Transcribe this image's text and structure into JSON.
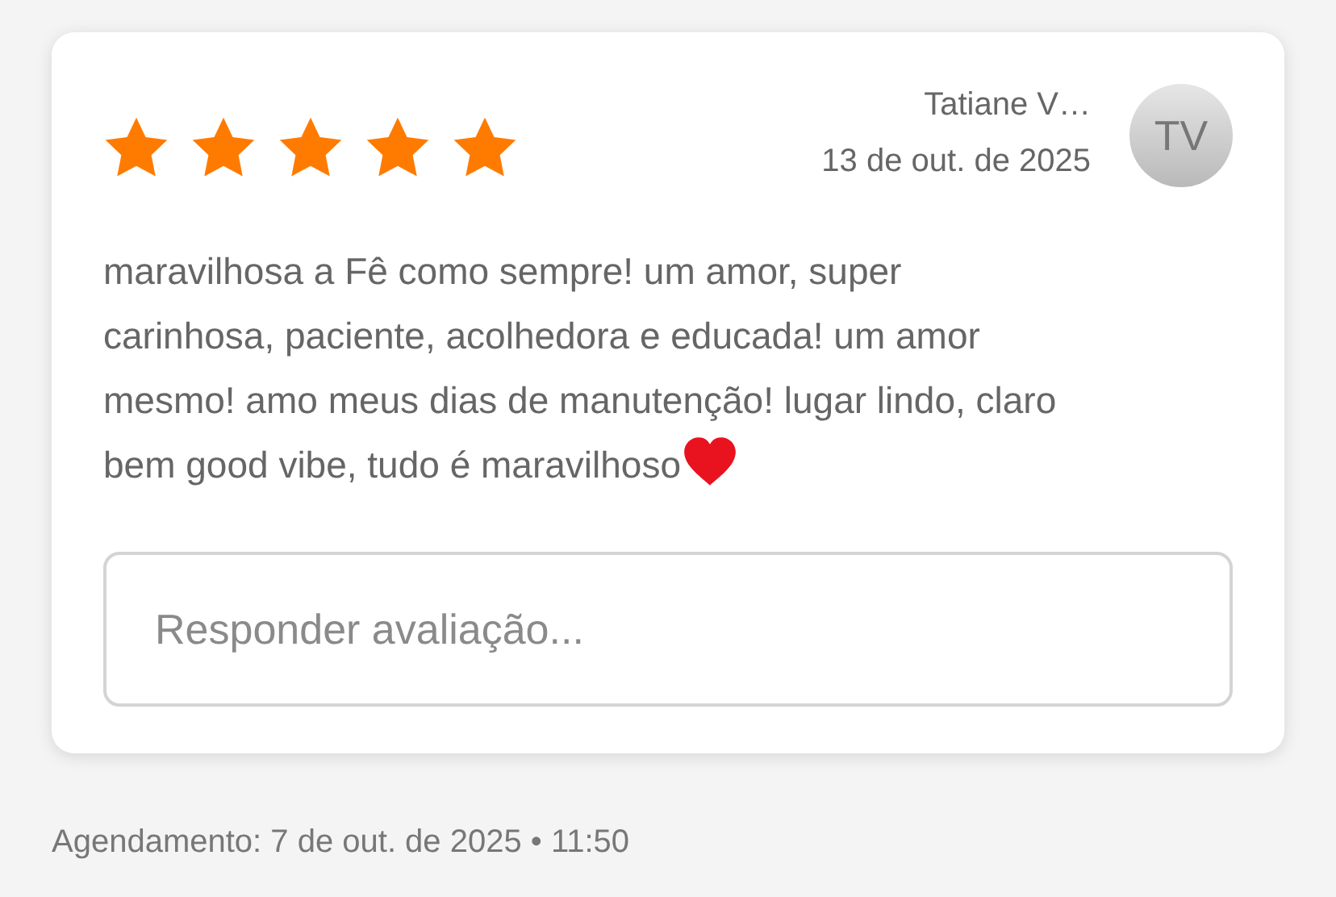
{
  "review": {
    "stars": 5,
    "author": "Tatiane V…",
    "date": "13 de out. de 2025",
    "avatar_initials": "TV",
    "text": "maravilhosa a Fê como sempre! um amor, super carinhosa, paciente, acolhedora e educada! um amor mesmo! amo meus dias de manutenção! lugar lindo, claro bem good vibe, tudo é maravilhoso",
    "reply": {
      "placeholder": "Responder avaliação..."
    }
  },
  "footer": "Agendamento: 7 de out. de 2025 • 11:50"
}
